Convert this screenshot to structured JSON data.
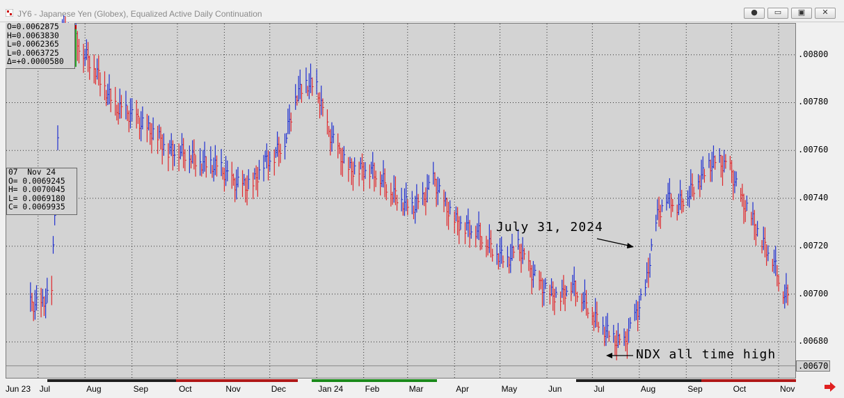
{
  "window": {
    "title": "JY6 - Japanese Yen (Globex), Equalized Active Daily Continuation",
    "buttons": [
      "●",
      "▭",
      "▣",
      "✕"
    ]
  },
  "ohlc_current": [
    "O=0.0062875",
    "H=0.0063830",
    "L=0.0062365",
    "L=0.0063725",
    "Δ=+0.0000580"
  ],
  "ohlc_cursor": [
    "07  Nov 24",
    "O= 0.0069245",
    "H= 0.0070045",
    "L= 0.0069180",
    "C= 0.0069935"
  ],
  "annotations": {
    "july": "July 31, 2024",
    "ndx": "NDX all time high"
  },
  "colors": {
    "up": "#1f2fd0",
    "down": "#e0262a",
    "background": "#d3d3d3"
  },
  "chart_data": {
    "type": "line",
    "title": "",
    "xlabel": "",
    "ylabel": "",
    "ylim": [
      0.00665,
      0.00813
    ],
    "y_ticks": [
      "0.00800",
      "0.00780",
      "0.00760",
      "0.00740",
      "0.00720",
      "0.00700",
      "0.00680"
    ],
    "y_last_label": ".00670",
    "x_tick_labels": [
      "Jun 23",
      "Jul",
      "Aug",
      "Sep",
      "Oct",
      "Nov",
      "Dec",
      "Jan 24",
      "Feb",
      "Mar",
      "Apr",
      "May",
      "Jun",
      "Jul",
      "Aug",
      "Sep",
      "Oct",
      "Nov"
    ],
    "x_months": [
      "2023-06",
      "2023-07",
      "2023-08",
      "2023-09",
      "2023-10",
      "2023-11",
      "2023-12",
      "2024-01",
      "2024-02",
      "2024-03",
      "2024-04",
      "2024-05",
      "2024-06",
      "2024-07",
      "2024-08",
      "2024-09",
      "2024-10",
      "2024-11"
    ],
    "grid": true,
    "series": [
      {
        "x": [
          "2023-06-26",
          "2023-07-03",
          "2023-07-10",
          "2023-07-17",
          "2023-07-24",
          "2023-07-31",
          "2023-08-07",
          "2023-08-14",
          "2023-08-21",
          "2023-08-28",
          "2023-09-04",
          "2023-09-11",
          "2023-09-18",
          "2023-09-25",
          "2023-10-02",
          "2023-10-09",
          "2023-10-16",
          "2023-10-23",
          "2023-10-30",
          "2023-11-06",
          "2023-11-13",
          "2023-11-20",
          "2023-11-27",
          "2023-12-04",
          "2023-12-11",
          "2023-12-18",
          "2023-12-25",
          "2024-01-01",
          "2024-01-08",
          "2024-01-15",
          "2024-01-22",
          "2024-01-29",
          "2024-02-05",
          "2024-02-12",
          "2024-02-19",
          "2024-02-26",
          "2024-03-04",
          "2024-03-11",
          "2024-03-18",
          "2024-03-25",
          "2024-04-01",
          "2024-04-08",
          "2024-04-15",
          "2024-04-22",
          "2024-04-29",
          "2024-05-06",
          "2024-05-13",
          "2024-05-20",
          "2024-05-27",
          "2024-06-03",
          "2024-06-10",
          "2024-06-17",
          "2024-06-24",
          "2024-07-01",
          "2024-07-08",
          "2024-07-15",
          "2024-07-22",
          "2024-07-29",
          "2024-08-05",
          "2024-08-12",
          "2024-08-19",
          "2024-08-26",
          "2024-09-02",
          "2024-09-09",
          "2024-09-16",
          "2024-09-23",
          "2024-09-30",
          "2024-10-07",
          "2024-10-14",
          "2024-10-21",
          "2024-10-28",
          "2024-11-04",
          "2024-11-07"
        ],
        "values": [
          0.00696,
          0.00695,
          0.00702,
          0.00811,
          0.00808,
          0.00801,
          0.00795,
          0.00786,
          0.00778,
          0.00776,
          0.00773,
          0.00769,
          0.00766,
          0.0076,
          0.0076,
          0.00758,
          0.00755,
          0.00754,
          0.00752,
          0.00747,
          0.00745,
          0.00746,
          0.00755,
          0.00758,
          0.00764,
          0.00783,
          0.00788,
          0.00786,
          0.00769,
          0.0076,
          0.00752,
          0.00752,
          0.00752,
          0.00749,
          0.00743,
          0.00739,
          0.00736,
          0.00739,
          0.00748,
          0.00738,
          0.00731,
          0.00728,
          0.00727,
          0.00722,
          0.00717,
          0.00714,
          0.0072,
          0.00711,
          0.00704,
          0.007,
          0.00699,
          0.00704,
          0.00699,
          0.00692,
          0.00686,
          0.00681,
          0.00679,
          0.0069,
          0.00702,
          0.00731,
          0.00741,
          0.00737,
          0.00742,
          0.00747,
          0.00754,
          0.00755,
          0.00752,
          0.0074,
          0.00732,
          0.00722,
          0.00715,
          0.00701,
          0.00699
        ]
      }
    ]
  }
}
